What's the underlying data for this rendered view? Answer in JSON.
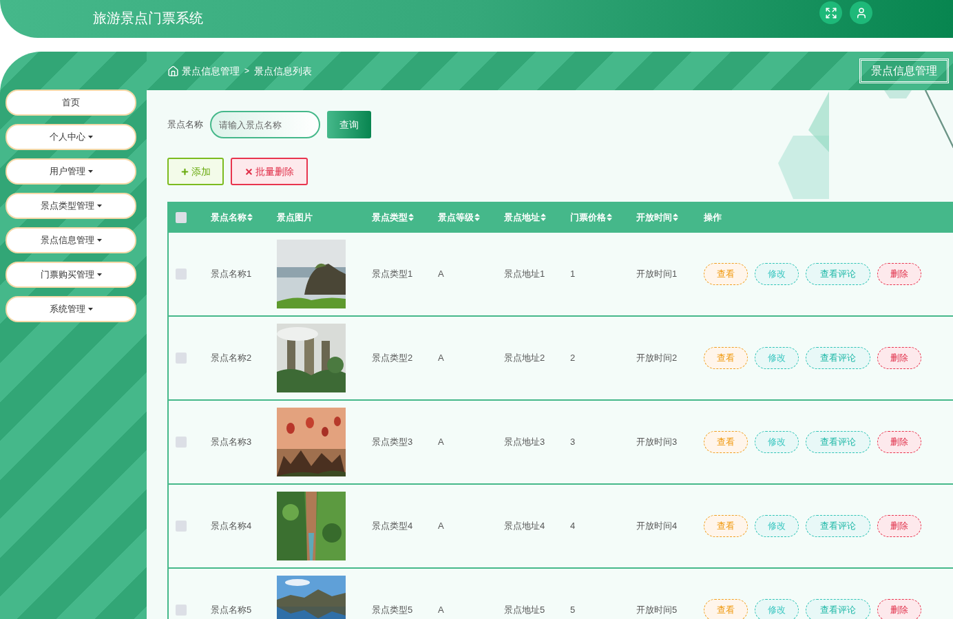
{
  "header": {
    "title": "旅游景点门票系统"
  },
  "breadcrumb": {
    "section": "景点信息管理",
    "separator": ">",
    "page": "景点信息列表"
  },
  "page_title": "景点信息管理",
  "sidebar": {
    "items": [
      {
        "label": "首页",
        "has_menu": false
      },
      {
        "label": "个人中心",
        "has_menu": true
      },
      {
        "label": "用户管理",
        "has_menu": true
      },
      {
        "label": "景点类型管理",
        "has_menu": true
      },
      {
        "label": "景点信息管理",
        "has_menu": true
      },
      {
        "label": "门票购买管理",
        "has_menu": true
      },
      {
        "label": "系统管理",
        "has_menu": true
      }
    ]
  },
  "search": {
    "label": "景点名称",
    "placeholder": "请输入景点名称",
    "button": "查询"
  },
  "actions": [
    {
      "kind": "add",
      "label": "添加"
    },
    {
      "kind": "batch_delete",
      "label": "批量删除"
    }
  ],
  "table": {
    "select_all": {
      "checked": false
    },
    "columns": [
      {
        "label": "景点名称",
        "sortable": true
      },
      {
        "label": "景点图片",
        "sortable": false
      },
      {
        "label": "景点类型",
        "sortable": true
      },
      {
        "label": "景点等级",
        "sortable": true
      },
      {
        "label": "景点地址",
        "sortable": true
      },
      {
        "label": "门票价格",
        "sortable": true
      },
      {
        "label": "开放时间",
        "sortable": true
      },
      {
        "label": "操作",
        "sortable": false
      }
    ],
    "rows": [
      {
        "checked": false,
        "name": "景点名称1",
        "type": "景点类型1",
        "level": "A",
        "address": "景点地址1",
        "price": "1",
        "hours": "开放时间1",
        "ops": [
          {
            "kind": "view",
            "label": "查看"
          },
          {
            "kind": "edit",
            "label": "修改"
          },
          {
            "kind": "comments",
            "label": "查看评论"
          },
          {
            "kind": "delete",
            "label": "删除"
          }
        ]
      },
      {
        "checked": false,
        "name": "景点名称2",
        "type": "景点类型2",
        "level": "A",
        "address": "景点地址2",
        "price": "2",
        "hours": "开放时间2",
        "ops": [
          {
            "kind": "view",
            "label": "查看"
          },
          {
            "kind": "edit",
            "label": "修改"
          },
          {
            "kind": "comments",
            "label": "查看评论"
          },
          {
            "kind": "delete",
            "label": "删除"
          }
        ]
      },
      {
        "checked": false,
        "name": "景点名称3",
        "type": "景点类型3",
        "level": "A",
        "address": "景点地址3",
        "price": "3",
        "hours": "开放时间3",
        "ops": [
          {
            "kind": "view",
            "label": "查看"
          },
          {
            "kind": "edit",
            "label": "修改"
          },
          {
            "kind": "comments",
            "label": "查看评论"
          },
          {
            "kind": "delete",
            "label": "删除"
          }
        ]
      },
      {
        "checked": false,
        "name": "景点名称4",
        "type": "景点类型4",
        "level": "A",
        "address": "景点地址4",
        "price": "4",
        "hours": "开放时间4",
        "ops": [
          {
            "kind": "view",
            "label": "查看"
          },
          {
            "kind": "edit",
            "label": "修改"
          },
          {
            "kind": "comments",
            "label": "查看评论"
          },
          {
            "kind": "delete",
            "label": "删除"
          }
        ]
      },
      {
        "checked": false,
        "name": "景点名称5",
        "type": "景点类型5",
        "level": "A",
        "address": "景点地址5",
        "price": "5",
        "hours": "开放时间5",
        "ops": [
          {
            "kind": "view",
            "label": "查看"
          },
          {
            "kind": "edit",
            "label": "修改"
          },
          {
            "kind": "comments",
            "label": "查看评论"
          },
          {
            "kind": "delete",
            "label": "删除"
          }
        ]
      }
    ]
  }
}
